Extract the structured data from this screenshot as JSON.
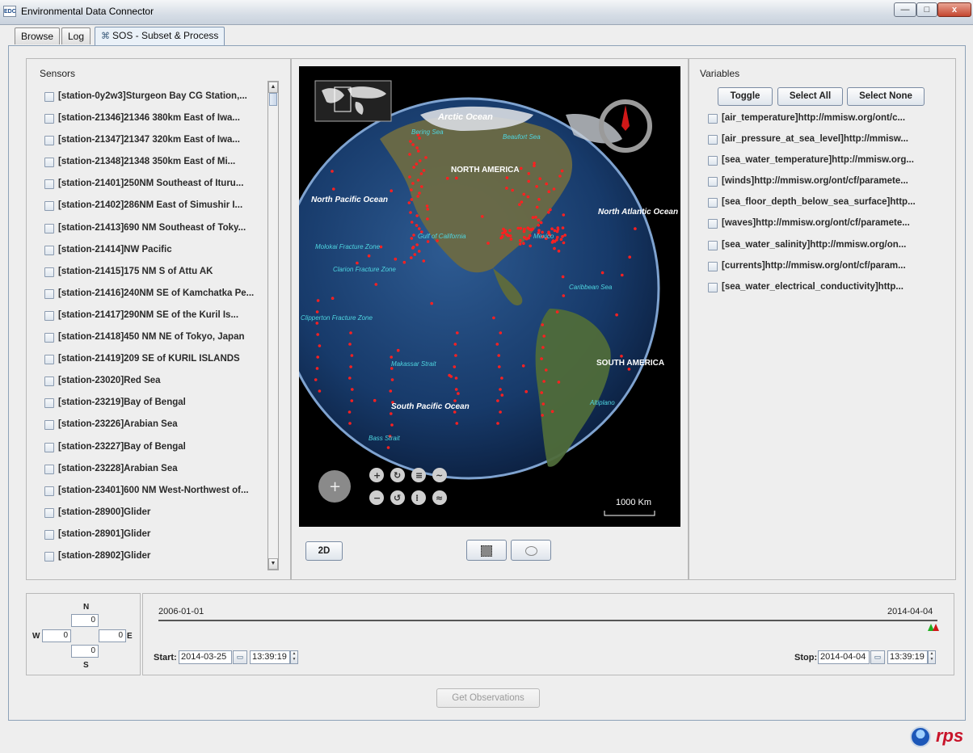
{
  "window": {
    "title": "Environmental Data Connector",
    "icon_text": "EDC",
    "controls": {
      "minimize": "—",
      "maximize": "□",
      "close": "x"
    }
  },
  "tabs": [
    {
      "label": "Browse"
    },
    {
      "label": "Log"
    },
    {
      "label": "SOS - Subset & Process",
      "active": true,
      "icon": "close-tab-icon"
    }
  ],
  "sensors": {
    "title": "Sensors",
    "items": [
      "[station-0y2w3]Sturgeon Bay CG Station,...",
      "[station-21346]21346  380km East of Iwa...",
      "[station-21347]21347  320km East of Iwa...",
      "[station-21348]21348   350km East of Mi...",
      "[station-21401]250NM Southeast of Ituru...",
      "[station-21402]286NM East of Simushir I...",
      "[station-21413]690 NM Southeast of Toky...",
      "[station-21414]NW Pacific",
      "[station-21415]175 NM S of Attu AK",
      "[station-21416]240NM SE of Kamchatka Pe...",
      "[station-21417]290NM SE of the Kuril Is...",
      "[station-21418]450 NM NE of Tokyo, Japan",
      "[station-21419]209 SE of KURIL ISLANDS",
      "[station-23020]Red Sea",
      "[station-23219]Bay of Bengal",
      "[station-23226]Arabian Sea",
      "[station-23227]Bay of Bengal",
      "[station-23228]Arabian Sea",
      "[station-23401]600 NM West-Northwest of...",
      "[station-28900]Glider",
      "[station-28901]Glider",
      "[station-28902]Glider"
    ]
  },
  "map": {
    "labels": {
      "arctic": "Arctic Ocean",
      "bering": "Bering Sea",
      "beaufort": "Beaufort Sea",
      "north_america": "NORTH AMERICA",
      "north_pacific": "North Pacific Ocean",
      "north_atlantic": "North Atlantic Ocean",
      "molokai": "Molokai Fracture Zone",
      "gulf_california": "Gulf of California",
      "mexico": "Mexico",
      "clarion": "Clarion Fracture Zone",
      "caribbean": "Caribbean Sea",
      "clipperton": "Clipperton Fracture Zone",
      "makassar": "Makassar Strait",
      "south_america": "SOUTH AMERICA",
      "south_pacific": "South Pacific Ocean",
      "altiplano": "Altiplano",
      "bass": "Bass Strait"
    },
    "scale": "1000 Km",
    "btn_2d": "2D",
    "tool_rect": "rectangle-select-icon",
    "tool_lasso": "lasso-select-icon"
  },
  "variables": {
    "title": "Variables",
    "buttons": {
      "toggle": "Toggle",
      "select_all": "Select All",
      "select_none": "Select None"
    },
    "items": [
      "[air_temperature]http://mmisw.org/ont/c...",
      "[air_pressure_at_sea_level]http://mmisw...",
      "[sea_water_temperature]http://mmisw.org...",
      "[winds]http://mmisw.org/ont/cf/paramete...",
      "[sea_floor_depth_below_sea_surface]http...",
      "[waves]http://mmisw.org/ont/cf/paramete...",
      "[sea_water_salinity]http://mmisw.org/on...",
      "[currents]http://mmisw.org/ont/cf/param...",
      "[sea_water_electrical_conductivity]http..."
    ]
  },
  "bbox": {
    "n_label": "N",
    "s_label": "S",
    "w_label": "W",
    "e_label": "E",
    "north": "0",
    "south": "0",
    "west": "0",
    "east": "0"
  },
  "timeline": {
    "range_start": "2006-01-01",
    "range_end": "2014-04-04",
    "start_label": "Start:",
    "start_date": "2014-03-25",
    "start_time": "13:39:19",
    "stop_label": "Stop:",
    "stop_date": "2014-04-04",
    "stop_time": "13:39:19"
  },
  "actions": {
    "get_observations": "Get Observations"
  },
  "footer": {
    "rps_logo": "rps"
  },
  "colors": {
    "station_marker": "#ff2020",
    "ocean": "#1e3f6e",
    "accent_red": "#d01818"
  }
}
